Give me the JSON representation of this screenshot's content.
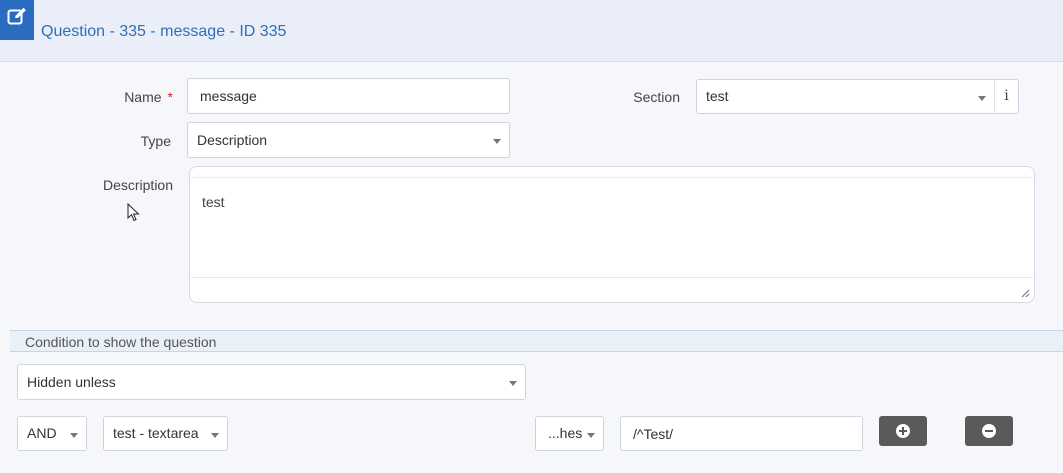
{
  "header": {
    "title": "Question - 335 - message - ID 335",
    "icon": "edit-icon"
  },
  "form": {
    "name_label": "Name",
    "required_mark": "*",
    "name_value": "message",
    "section_label": "Section",
    "section_value": "test",
    "info_label": "i",
    "type_label": "Type",
    "type_value": "Description",
    "description_label": "Description",
    "description_value": "test"
  },
  "condition": {
    "title": "Condition to show the question",
    "visibility_value": "Hidden unless",
    "operator_value": "AND",
    "field_value": "test - textarea",
    "match_value": "...hes",
    "pattern_value": "/^Test/",
    "add_icon": "plus-circle-icon",
    "remove_icon": "minus-circle-icon"
  },
  "colors": {
    "accent": "#2a6cc0",
    "title": "#2f6fb8",
    "required": "#d9262c",
    "dark_button": "#5a5a5a"
  }
}
